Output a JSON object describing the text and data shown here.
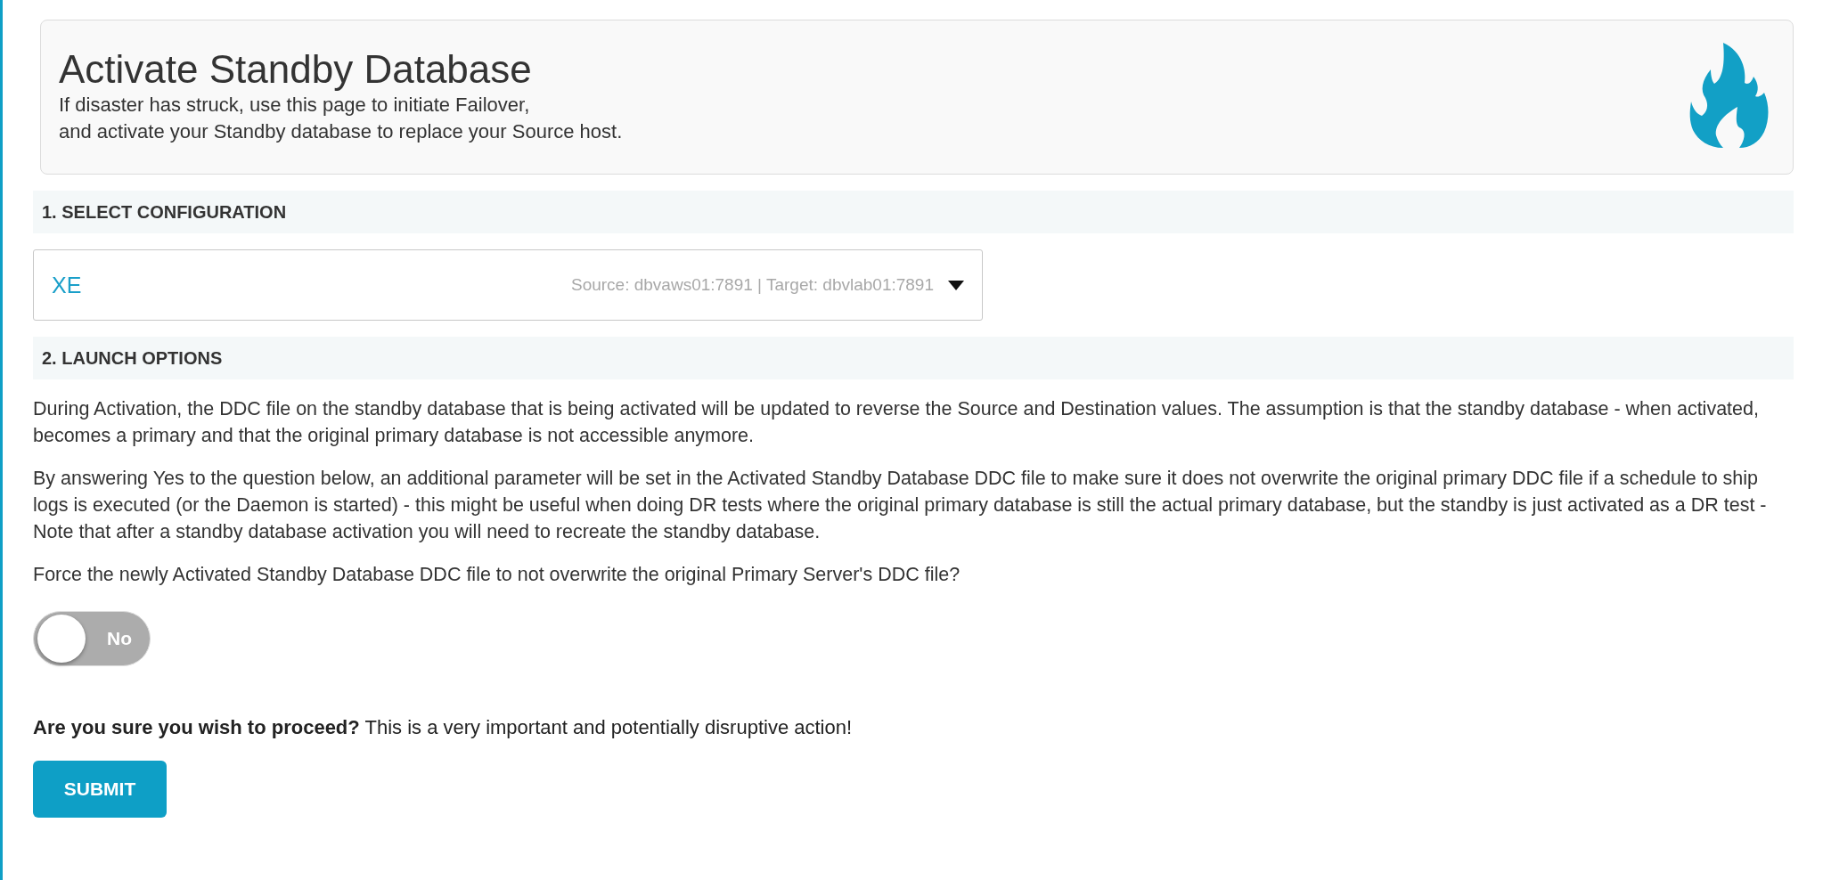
{
  "header": {
    "title": "Activate Standby Database",
    "subtitle_lines": [
      "If disaster has struck, use this page to initiate Failover,",
      "and activate your Standby database to replace your Source host."
    ]
  },
  "sections": [
    {
      "heading": "1. SELECT CONFIGURATION"
    },
    {
      "heading": "2. LAUNCH OPTIONS"
    }
  ],
  "config_select": {
    "value": "XE",
    "detail": "Source: dbvaws01:7891 | Target: dbvlab01:7891"
  },
  "paragraphs": [
    "During Activation, the DDC file on the standby database that is being activated will be updated to reverse the Source and Destination values. The assumption is that the standby database - when activated, becomes a primary and that the original primary database is not accessible anymore.",
    "By answering Yes to the question below, an additional parameter will be set in the Activated Standby Database DDC file to make sure it does not overwrite the original primary DDC file if a schedule to ship logs is executed (or the Daemon is started) - this might be useful when doing DR tests where the original primary database is still the actual primary database, but the standby is just activated as a DR test - Note that after a standby database activation you will need to recreate the standby database.",
    "Force the newly Activated Standby Database DDC file to not overwrite the original Primary Server's DDC file?"
  ],
  "force_toggle": {
    "on": false,
    "label": "No"
  },
  "confirm": "**Are you sure you wish to proceed?** This is a very important and potentially disruptive action!",
  "submit_button": "SUBMIT"
}
